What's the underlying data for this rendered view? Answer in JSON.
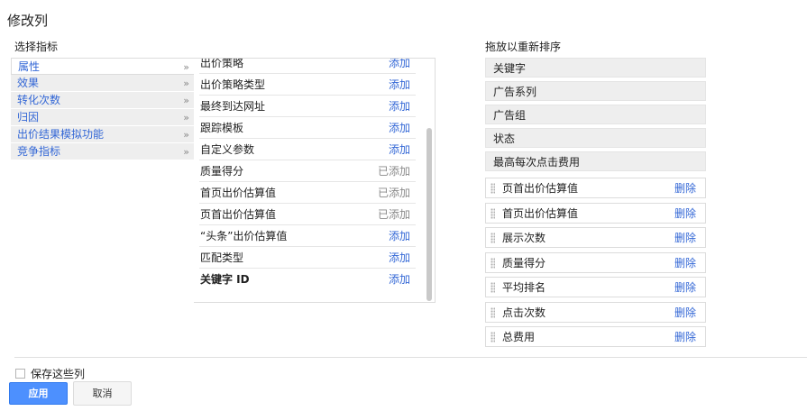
{
  "title": "修改列",
  "left_section_label": "选择指标",
  "right_section_label": "拖放以重新排序",
  "categories": [
    {
      "label": "属性",
      "arrow": "»",
      "active": true
    },
    {
      "label": "效果",
      "arrow": "»"
    },
    {
      "label": "转化次数",
      "arrow": "»"
    },
    {
      "label": "归因",
      "arrow": "»"
    },
    {
      "label": "出价结果模拟功能",
      "arrow": "»"
    },
    {
      "label": "竞争指标",
      "arrow": "»"
    }
  ],
  "metrics": [
    {
      "name": "出价策略",
      "action": "添加"
    },
    {
      "name": "出价策略类型",
      "action": "添加"
    },
    {
      "name": "最终到达网址",
      "action": "添加"
    },
    {
      "name": "跟踪模板",
      "action": "添加"
    },
    {
      "name": "自定义参数",
      "action": "添加"
    },
    {
      "name": "质量得分",
      "action": "已添加",
      "added": true
    },
    {
      "name": "首页出价估算值",
      "action": "已添加",
      "added": true
    },
    {
      "name": "页首出价估算值",
      "action": "已添加",
      "added": true
    },
    {
      "name": "“头条”出价估算值",
      "action": "添加"
    },
    {
      "name": "匹配类型",
      "action": "添加"
    },
    {
      "name": "关键字 ID",
      "action": "添加"
    }
  ],
  "fixed_columns": [
    "关键字",
    "广告系列",
    "广告组",
    "状态",
    "最高每次点击费用"
  ],
  "selected_columns": [
    {
      "name": "页首出价估算值",
      "action": "删除"
    },
    {
      "name": "首页出价估算值",
      "action": "删除"
    },
    {
      "name": "展示次数",
      "action": "删除"
    },
    {
      "name": "质量得分",
      "action": "删除"
    },
    {
      "name": "平均排名",
      "action": "删除"
    },
    {
      "name": "点击次数",
      "action": "删除"
    },
    {
      "name": "总费用",
      "action": "删除"
    }
  ],
  "save_label": "保存这些列",
  "apply_label": "应用",
  "cancel_label": "取消"
}
